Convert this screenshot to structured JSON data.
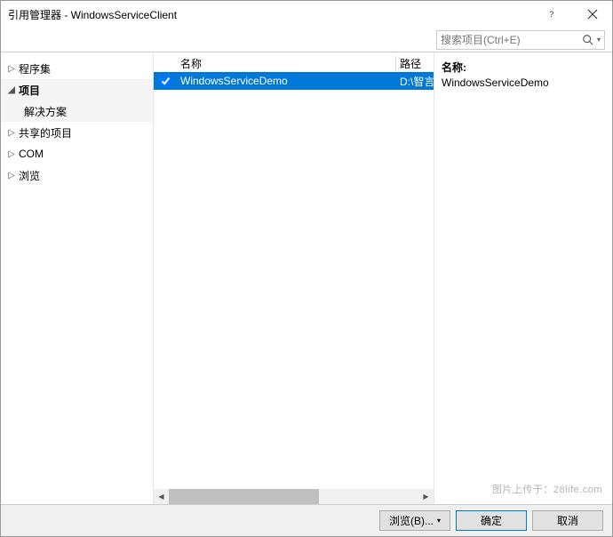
{
  "window": {
    "title": "引用管理器 - WindowsServiceClient"
  },
  "search": {
    "placeholder": "搜索项目(Ctrl+E)"
  },
  "sidebar": {
    "items": [
      {
        "label": "程序集"
      },
      {
        "label": "项目"
      },
      {
        "label": "共享的项目"
      },
      {
        "label": "COM"
      },
      {
        "label": "浏览"
      }
    ],
    "sub_label": "解决方案"
  },
  "list": {
    "header": {
      "name": "名称",
      "path": "路径"
    },
    "rows": [
      {
        "checked": true,
        "name": "WindowsServiceDemo",
        "path": "D:\\智言"
      }
    ]
  },
  "details": {
    "name_label": "名称:",
    "name_value": "WindowsServiceDemo"
  },
  "footer": {
    "browse": "浏览(B)...",
    "ok": "确定",
    "cancel": "取消"
  },
  "watermark": "图片上传于：28life.com"
}
